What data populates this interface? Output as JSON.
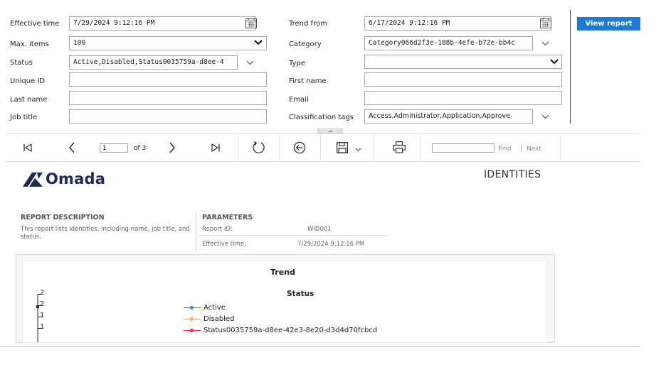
{
  "params": {
    "effective_time_label": "Effective time",
    "effective_time_value": "7/29/2024 9:12:16 PM",
    "trend_from_label": "Trend from",
    "trend_from_value": "6/17/2024 9:12:16 PM",
    "max_items_label": "Max. items",
    "max_items_value": "100",
    "category_label": "Category",
    "category_value": "Category066d2f3e-188b-4efe-b72e-bb4c",
    "status_label": "Status",
    "status_value": "Active,Disabled,Status0035759a-d8ee-4",
    "type_label": "Type",
    "type_value": "",
    "unique_id_label": "Unique ID",
    "unique_id_value": "",
    "first_name_label": "First name",
    "first_name_value": "",
    "last_name_label": "Last name",
    "last_name_value": "",
    "email_label": "Email",
    "email_value": "",
    "job_title_label": "Job title",
    "job_title_value": "",
    "classification_label": "Classification tags",
    "classification_value": "Access,Administrator,Application,Approve",
    "view_report_label": "View report"
  },
  "toolbar": {
    "page_current": "1",
    "page_of": "of 3",
    "find_value": "",
    "find_label": "Find",
    "next_label": "Next"
  },
  "report": {
    "logo_text": "Omada",
    "title": "IDENTITIES",
    "description_heading": "REPORT DESCRIPTION",
    "description_text": "This report lists identities, including name, job title, and status.",
    "parameters_heading": "PARAMETERS",
    "report_id_label": "Report ID:",
    "report_id_value": "WID001",
    "effective_time_label": "Effective time:",
    "effective_time_value": "7/29/2024 9:12:16 PM"
  },
  "chart_data": {
    "type": "line",
    "title": "Trend",
    "subtitle": "Status",
    "y_ticks": [
      "2",
      "2",
      "1",
      "1"
    ],
    "series": [
      {
        "name": "Active",
        "color": "#3b7dd8"
      },
      {
        "name": "Disabled",
        "color": "#f0b030"
      },
      {
        "name": "Status0035759a-d8ee-42e3-8e20-d3d4d70fcbcd",
        "color": "#d43a2a"
      }
    ]
  },
  "colors": {
    "accent": "#1c7bd8",
    "logo": "#1e2a56"
  }
}
